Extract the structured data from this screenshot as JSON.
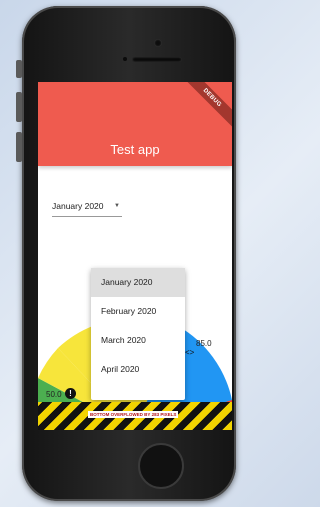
{
  "app": {
    "title": "Test app",
    "debug_banner": "DEBUG"
  },
  "dropdown": {
    "selected": "January 2020",
    "options": [
      "January 2020",
      "February 2020",
      "March 2020",
      "April 2020"
    ],
    "highlighted_index": 0
  },
  "chart_data": {
    "type": "pie",
    "labels": {
      "left_value": "50.0",
      "right_value": "85.0"
    },
    "colors": {
      "yellow": "#f7e53b",
      "blue": "#2196f3",
      "green": "#4caf50",
      "red": "#f44336"
    }
  },
  "overflow": {
    "text": "BOTTOM OVERFLOWED BY 283 PIXELS"
  },
  "icons": {
    "badge": "!",
    "chevrons": "<>"
  }
}
